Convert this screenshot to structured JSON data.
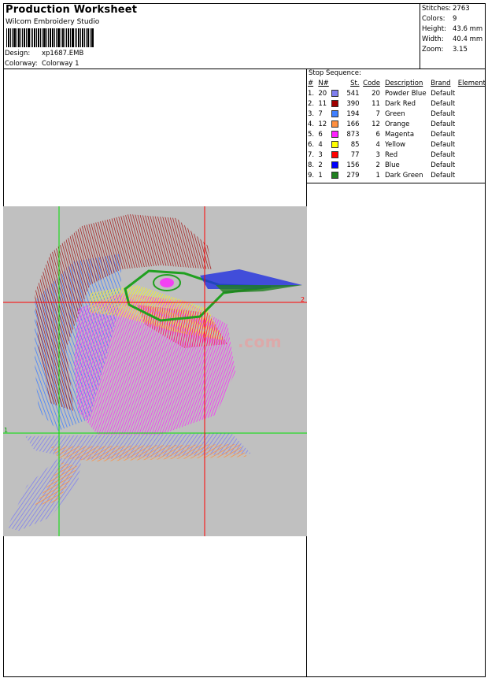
{
  "header": {
    "title": "Production Worksheet",
    "software": "Wilcom Embroidery Studio",
    "design_label": "Design:",
    "design_value": "xp1687.EMB",
    "colorway_label": "Colorway:",
    "colorway_value": "Colorway 1"
  },
  "stats": [
    {
      "label": "Stitches:",
      "value": "2763"
    },
    {
      "label": "Colors:",
      "value": "9"
    },
    {
      "label": "Height:",
      "value": "43.6 mm"
    },
    {
      "label": "Width:",
      "value": "40.4 mm"
    },
    {
      "label": "Zoom:",
      "value": "3.15"
    }
  ],
  "stop_sequence": {
    "title": "Stop Sequence:",
    "headers": {
      "num": "#",
      "n": "N#",
      "st": "St.",
      "code": "Code",
      "desc": "Description",
      "brand": "Brand",
      "element": "Element"
    },
    "rows": [
      {
        "num": "1.",
        "n": "20",
        "color": "#8080f0",
        "st": "541",
        "code": "20",
        "desc": "Powder Blue",
        "brand": "Default"
      },
      {
        "num": "2.",
        "n": "11",
        "color": "#a00000",
        "st": "390",
        "code": "11",
        "desc": "Dark Red",
        "brand": "Default"
      },
      {
        "num": "3.",
        "n": "7",
        "color": "#4080ff",
        "st": "194",
        "code": "7",
        "desc": "Green",
        "brand": "Default"
      },
      {
        "num": "4.",
        "n": "12",
        "color": "#ff9040",
        "st": "166",
        "code": "12",
        "desc": "Orange",
        "brand": "Default"
      },
      {
        "num": "5.",
        "n": "6",
        "color": "#ff20ff",
        "st": "873",
        "code": "6",
        "desc": "Magenta",
        "brand": "Default"
      },
      {
        "num": "6.",
        "n": "4",
        "color": "#ffff00",
        "st": "85",
        "code": "4",
        "desc": "Yellow",
        "brand": "Default"
      },
      {
        "num": "7.",
        "n": "3",
        "color": "#ff0000",
        "st": "77",
        "code": "3",
        "desc": "Red",
        "brand": "Default"
      },
      {
        "num": "8.",
        "n": "2",
        "color": "#0000ff",
        "st": "156",
        "code": "2",
        "desc": "Blue",
        "brand": "Default"
      },
      {
        "num": "9.",
        "n": "1",
        "color": "#208020",
        "st": "279",
        "code": "1",
        "desc": "Dark Green",
        "brand": "Default"
      }
    ]
  },
  "preview": {
    "background": "#c0c0c0",
    "guide_green": "#00e000",
    "guide_red": "#ff0000",
    "marker_1": "1",
    "marker_2": "2",
    "watermark": ".com"
  }
}
